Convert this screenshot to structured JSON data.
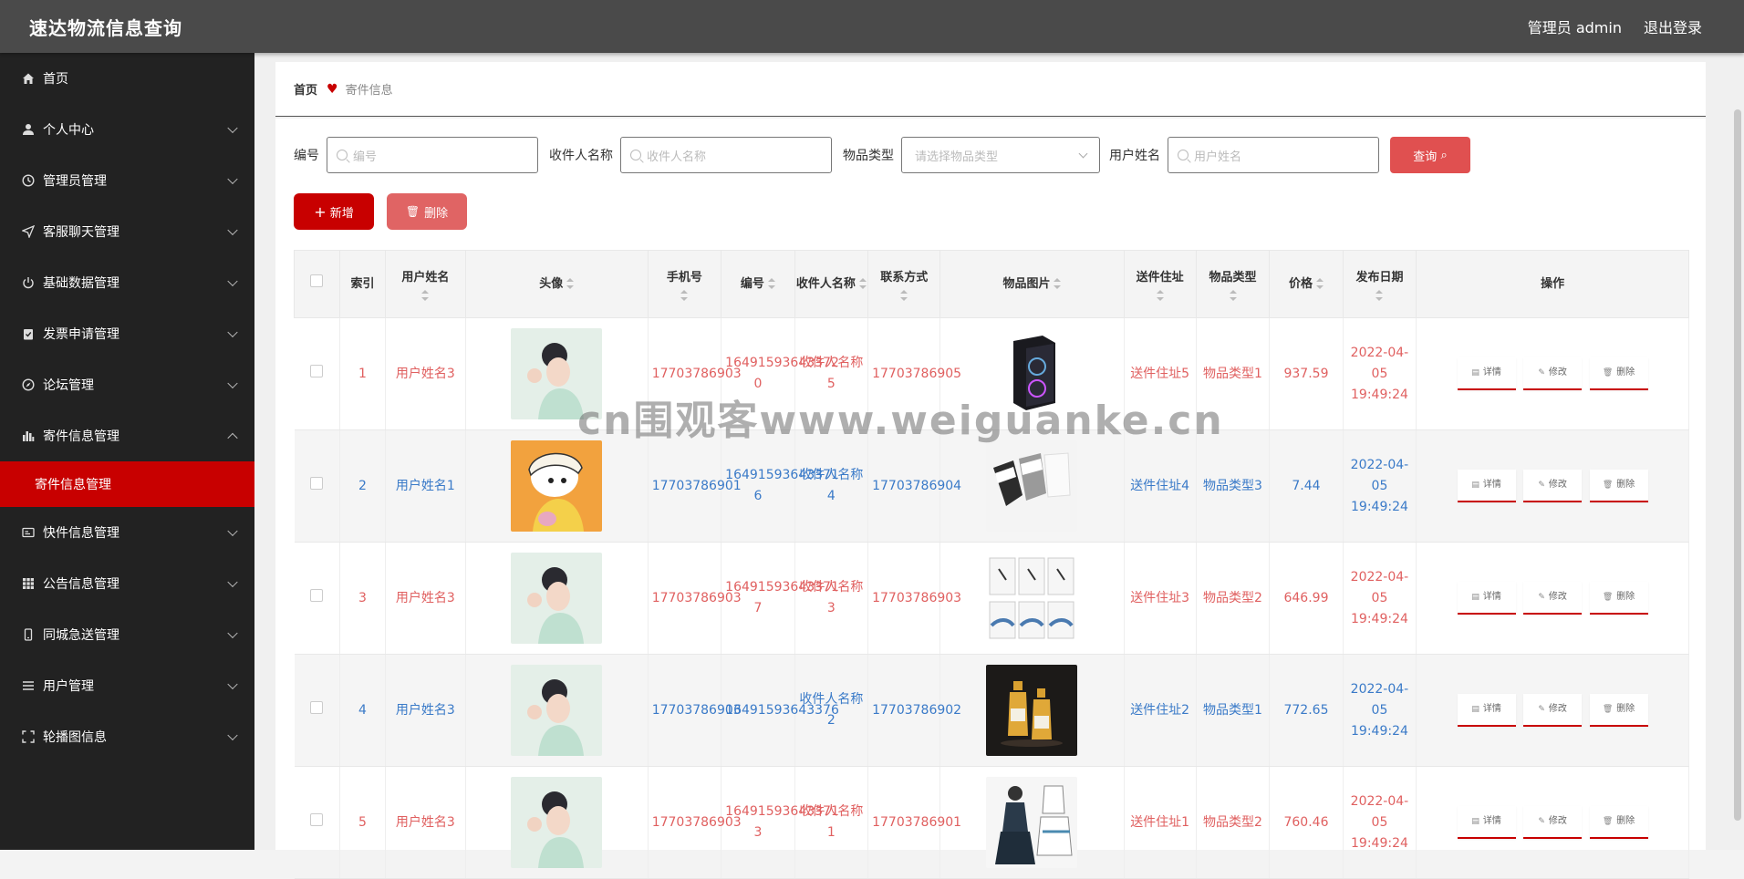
{
  "header": {
    "title": "速达物流信息查询",
    "admin": "管理员 admin",
    "logout": "退出登录"
  },
  "sidebar": {
    "items": [
      {
        "label": "首页",
        "icon": "home-icon"
      },
      {
        "label": "个人中心",
        "icon": "user-icon"
      },
      {
        "label": "管理员管理",
        "icon": "clock-icon"
      },
      {
        "label": "客服聊天管理",
        "icon": "send-icon"
      },
      {
        "label": "基础数据管理",
        "icon": "power-icon"
      },
      {
        "label": "发票申请管理",
        "icon": "clipboard-icon"
      },
      {
        "label": "论坛管理",
        "icon": "compass-icon"
      },
      {
        "label": "寄件信息管理",
        "icon": "bar-chart-icon"
      },
      {
        "label": "快件信息管理",
        "icon": "card-icon"
      },
      {
        "label": "公告信息管理",
        "icon": "grid-icon"
      },
      {
        "label": "同城急送管理",
        "icon": "phone-icon"
      },
      {
        "label": "用户管理",
        "icon": "list-icon"
      },
      {
        "label": "轮播图信息",
        "icon": "fullscreen-icon"
      }
    ],
    "active_sub": "寄件信息管理"
  },
  "breadcrumb": {
    "home": "首页",
    "current": "寄件信息"
  },
  "search": {
    "f1_label": "编号",
    "f1_placeholder": "编号",
    "f2_label": "收件人名称",
    "f2_placeholder": "收件人名称",
    "f3_label": "物品类型",
    "f3_placeholder": "请选择物品类型",
    "f4_label": "用户姓名",
    "f4_placeholder": "用户姓名",
    "query": "查询"
  },
  "actions": {
    "add": "新增",
    "delete": "删除"
  },
  "table": {
    "headers": {
      "index": "索引",
      "username": "用户姓名",
      "avatar": "头像",
      "phone": "手机号",
      "code": "编号",
      "receiver": "收件人名称",
      "contact": "联系方式",
      "item_img": "物品图片",
      "address": "送件住址",
      "type": "物品类型",
      "price": "价格",
      "date": "发布日期",
      "ops": "操作"
    },
    "op_labels": {
      "detail": "详情",
      "edit": "修改",
      "delete": "删除"
    },
    "rows": [
      {
        "index": "1",
        "username": "用户姓名3",
        "phone": "17703786903",
        "code": "16491593643372 0",
        "receiver": "收件人名称5",
        "contact": "17703786905",
        "address": "送件住址5",
        "type": "物品类型1",
        "price": "937.59",
        "date": "2022-04-05 19:49:24",
        "avatar": "woman-portrait",
        "item": "pc-case"
      },
      {
        "index": "2",
        "username": "用户姓名1",
        "phone": "17703786901",
        "code": "16491593643371 6",
        "receiver": "收件人名称4",
        "contact": "17703786904",
        "address": "送件住址4",
        "type": "物品类型3",
        "price": "7.44",
        "date": "2022-04-05 19:49:24",
        "avatar": "cartoon-boy",
        "item": "socks"
      },
      {
        "index": "3",
        "username": "用户姓名3",
        "phone": "17703786903",
        "code": "16491593643371 7",
        "receiver": "收件人名称3",
        "contact": "17703786903",
        "address": "送件住址3",
        "type": "物品类型2",
        "price": "646.99",
        "date": "2022-04-05 19:49:24",
        "avatar": "woman-portrait",
        "item": "shirts"
      },
      {
        "index": "4",
        "username": "用户姓名3",
        "phone": "17703786903",
        "code": "16491593643376",
        "receiver": "收件人名称2",
        "contact": "17703786902",
        "address": "送件住址2",
        "type": "物品类型1",
        "price": "772.65",
        "date": "2022-04-05 19:49:24",
        "avatar": "woman-portrait",
        "item": "bottles"
      },
      {
        "index": "5",
        "username": "用户姓名3",
        "phone": "17703786903",
        "code": "16491593643371 3",
        "receiver": "收件人名称1",
        "contact": "17703786901",
        "address": "送件住址1",
        "type": "物品类型2",
        "price": "760.46",
        "date": "2022-04-05 19:49:24",
        "avatar": "woman-portrait",
        "item": "dress-sketch"
      }
    ]
  },
  "watermark": "cn围观客www.weiguanke.cn",
  "colors": {
    "accent": "#c80000",
    "header_bg": "#4a4a4a",
    "sidebar_bg": "#222222",
    "red_text": "#e06060",
    "blue_text": "#3a7ac8"
  }
}
